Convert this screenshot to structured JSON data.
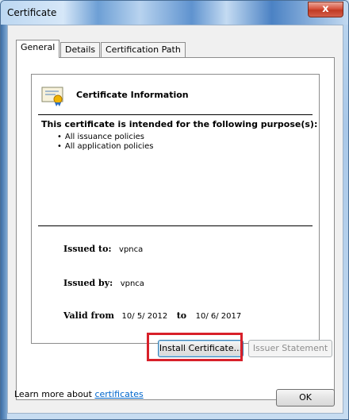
{
  "window": {
    "title": "Certificate",
    "close_label": "x"
  },
  "tabs": [
    {
      "label": "General",
      "active": true
    },
    {
      "label": "Details",
      "active": false
    },
    {
      "label": "Certification Path",
      "active": false
    }
  ],
  "certificate": {
    "icon": "certificate-icon",
    "info_title": "Certificate Information",
    "purpose_heading": "This certificate is intended for the following purpose(s):",
    "purposes": [
      "All issuance policies",
      "All application policies"
    ],
    "issued_to_label": "Issued to:",
    "issued_to_value": "vpnca",
    "issued_by_label": "Issued by:",
    "issued_by_value": "vpnca",
    "valid_from_label": "Valid from",
    "valid_from_value": "10/ 5/ 2012",
    "valid_to_label": "to",
    "valid_to_value": "10/ 6/ 2017"
  },
  "buttons": {
    "install": "Install Certificate...",
    "issuer_statement": "Issuer Statement",
    "ok": "OK"
  },
  "footer": {
    "learn_prefix": "Learn more about",
    "learn_link": "certificates"
  },
  "colors": {
    "highlight": "#d8202a",
    "link": "#0066cc"
  }
}
